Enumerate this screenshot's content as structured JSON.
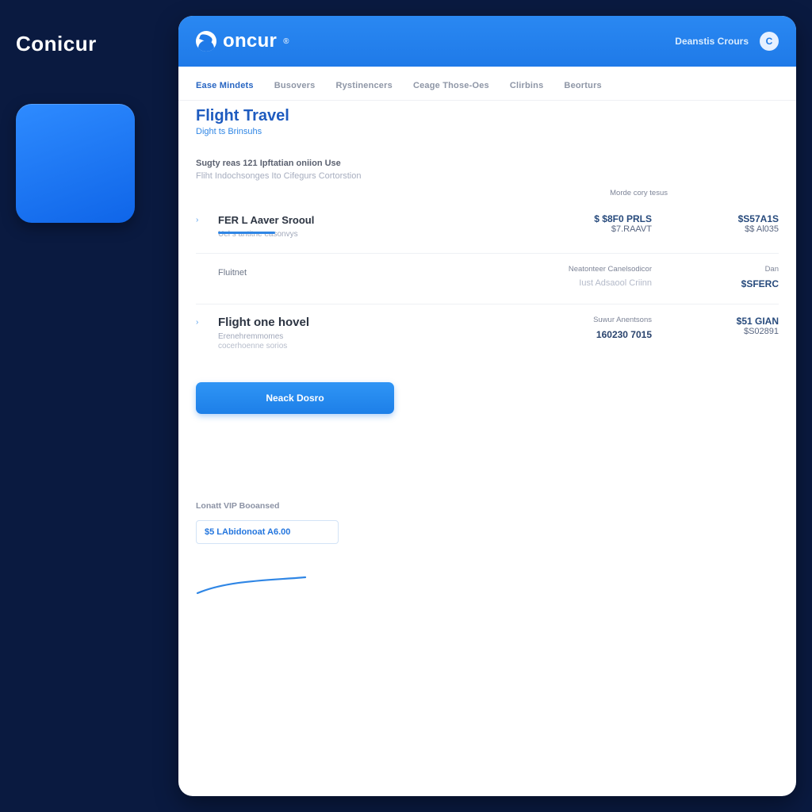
{
  "outer": {
    "brand": "Conicur"
  },
  "header": {
    "logo_text": "oncur",
    "account_link": "Deanstis Crours",
    "avatar_initial": "C"
  },
  "tabs": [
    {
      "label": "Ease Mindets"
    },
    {
      "label": "Busovers"
    },
    {
      "label": "Rystinencers"
    },
    {
      "label": "Ceage Those-Oes"
    },
    {
      "label": "Clirbins"
    },
    {
      "label": "Beorturs"
    }
  ],
  "page": {
    "title": "Flight Travel",
    "breadcrumb": "Dight ts Brinsuhs",
    "desc_line1": "Sugty reas 121 Ipftatian oniion Use",
    "desc_line2": "Fliht Indochsonges Ito Cifegurs Cortorstion"
  },
  "columns": {
    "mid_header": "Morde cory tesus"
  },
  "items": [
    {
      "caret": "›",
      "title": "FER L Aaver Srooul",
      "sub": "Uel s antitne easonvys",
      "mid_val1": "$  $8F0 PRLS",
      "mid_val2": "$7.RAAVT",
      "right_val1": "$S57A1S",
      "right_val2": "$$ Al035"
    },
    {
      "caret": "",
      "title": "Fluitnet",
      "sub": "",
      "mid_header": "Neatonteer Canelsodicor",
      "mid_val1": "Iust Adsaool Criinn",
      "right_header": "Dan",
      "right_val1": "$SFERC"
    },
    {
      "caret": "›",
      "title": "Flight one hovel",
      "sub": "Erenehremmomes",
      "sub2": "cocerhoenne sorios",
      "mid_header": "Suwur Anentsons",
      "mid_val1": "160230 7015",
      "right_val1": "$51 GIAN",
      "right_val2": "$S02891"
    }
  ],
  "cta": {
    "label": "Neack Dosro"
  },
  "lower": {
    "label": "Lonatt VIP Booansed",
    "field_text": "$5 LAbidonoat A6.00"
  }
}
